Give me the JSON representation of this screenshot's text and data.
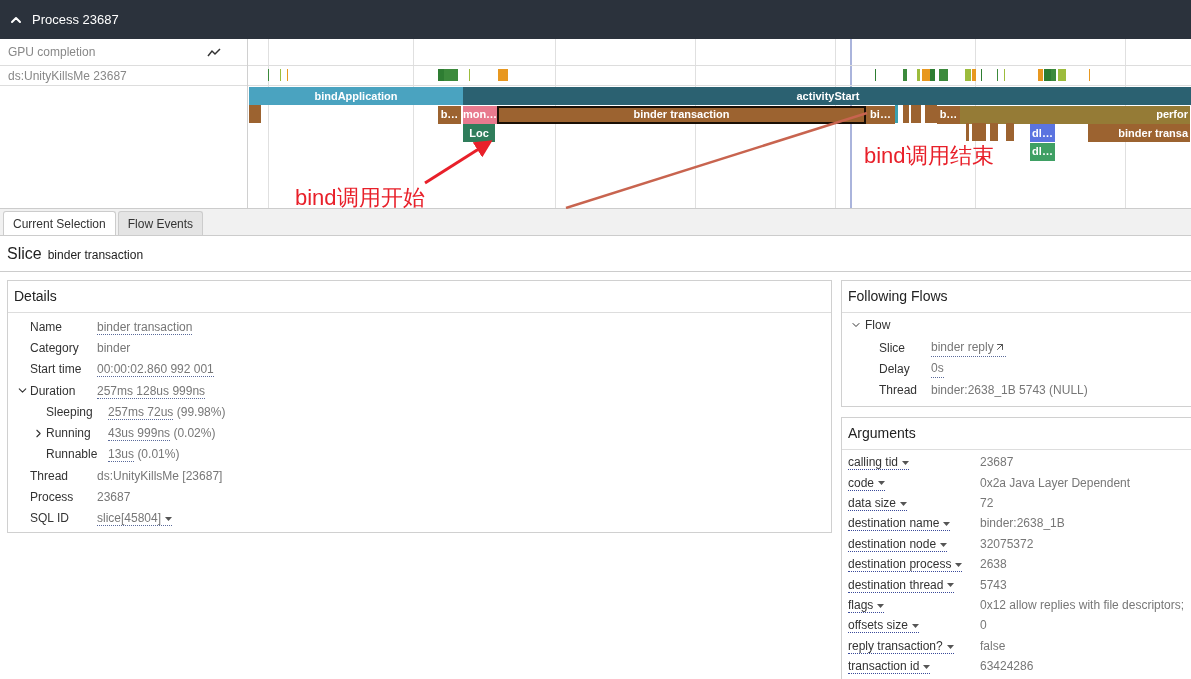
{
  "header": {
    "title": "Process 23687",
    "expanded": true
  },
  "tracks": [
    {
      "label": "GPU completion",
      "kind": "counter"
    },
    {
      "label": "ds:UnityKillsMe 23687",
      "kind": "thread"
    }
  ],
  "slices": [
    {
      "label": "bindApplication",
      "color": "#4aa3c0",
      "selected": false
    },
    {
      "label": "activityStart",
      "color": "#2b6171",
      "selected": false
    },
    {
      "label": "b…",
      "color": "#9c6330",
      "selected": false
    },
    {
      "label": "mon…",
      "color": "#e87a8e",
      "selected": false
    },
    {
      "label": "binder transaction",
      "color": "#9c6330",
      "selected": true
    },
    {
      "label": "bi…",
      "color": "#9c6330",
      "selected": false
    },
    {
      "label": "b…",
      "color": "#9c6330",
      "selected": false
    },
    {
      "label": "perfor",
      "color": "#957b36",
      "selected": false
    },
    {
      "label": "Loc",
      "color": "#2f7d5b",
      "selected": false
    },
    {
      "label": "dl…",
      "color": "#5b74e0",
      "selected": false
    },
    {
      "label": "binder transa",
      "color": "#9c6330",
      "selected": false
    },
    {
      "label": "dl…",
      "color": "#3fa064",
      "selected": false
    }
  ],
  "annotations": [
    {
      "text": "bind调用开始"
    },
    {
      "text": "bind调用结束"
    }
  ],
  "tabs": [
    {
      "label": "Current Selection",
      "selected": true
    },
    {
      "label": "Flow Events",
      "selected": false
    }
  ],
  "selection": {
    "kind": "Slice",
    "name": "binder transaction"
  },
  "details": {
    "title": "Details",
    "rows": [
      {
        "label": "Name",
        "link": "binder transaction"
      },
      {
        "label": "Category",
        "text": "binder"
      },
      {
        "label": "Start time",
        "link": "00:00:02.860 992 001"
      },
      {
        "label": "Duration",
        "link": "257ms 128us 999ns",
        "expanded": true,
        "children": [
          {
            "label": "Sleeping",
            "link": "257ms 72us",
            "text": "(99.98%)"
          },
          {
            "label": "Running",
            "link": "43us 999ns",
            "text": "(0.02%)",
            "expanded": false
          },
          {
            "label": "Runnable",
            "link": "13us",
            "text": "(0.01%)"
          }
        ]
      },
      {
        "label": "Thread",
        "text": "ds:UnityKillsMe [23687]"
      },
      {
        "label": "Process",
        "text": "23687"
      },
      {
        "label": "SQL ID",
        "link": "slice[45804]",
        "menu": true
      }
    ]
  },
  "flows": {
    "title": "Following Flows",
    "group": "Flow",
    "expanded": true,
    "rows": [
      {
        "label": "Slice",
        "link": "binder reply",
        "external": true
      },
      {
        "label": "Delay",
        "link": "0s"
      },
      {
        "label": "Thread",
        "text": "binder:2638_1B 5743 (NULL)"
      }
    ]
  },
  "arguments": {
    "title": "Arguments",
    "rows": [
      {
        "key": "calling tid",
        "value": "23687"
      },
      {
        "key": "code",
        "value": "0x2a Java Layer Dependent"
      },
      {
        "key": "data size",
        "value": "72"
      },
      {
        "key": "destination name",
        "value": "binder:2638_1B"
      },
      {
        "key": "destination node",
        "value": "32075372"
      },
      {
        "key": "destination process",
        "value": "2638"
      },
      {
        "key": "destination thread",
        "value": "5743"
      },
      {
        "key": "flags",
        "value": "0x12 allow replies with file descriptors;"
      },
      {
        "key": "offsets size",
        "value": "0"
      },
      {
        "key": "reply transaction?",
        "value": "false"
      },
      {
        "key": "transaction id",
        "value": "63424286"
      }
    ]
  }
}
